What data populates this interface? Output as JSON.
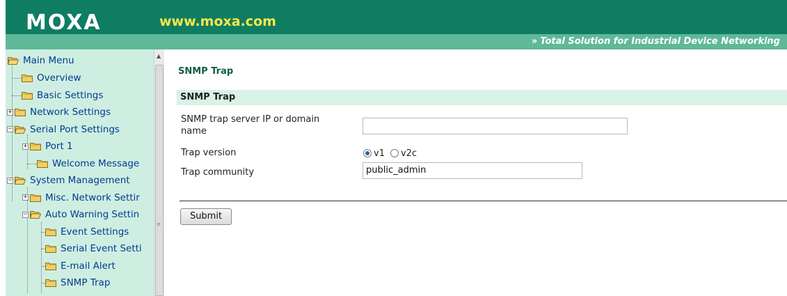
{
  "header": {
    "logo_text": "MOXA",
    "logo_url": "www.moxa.com",
    "tagline_arrows": "»",
    "tagline": "Total Solution for Industrial Device Networking",
    "colors": {
      "dark_green": "#0f7d62",
      "light_green": "#5fb89a",
      "url_yellow": "#f7e84a"
    }
  },
  "sidebar": {
    "root": "Main Menu",
    "items": [
      {
        "label": "Overview",
        "expander": "",
        "icon": "folder-closed-icon"
      },
      {
        "label": "Basic Settings",
        "expander": "",
        "icon": "folder-closed-icon"
      },
      {
        "label": "Network Settings",
        "expander": "+",
        "icon": "folder-closed-icon"
      },
      {
        "label": "Serial Port Settings",
        "expander": "-",
        "icon": "folder-open-icon"
      },
      {
        "label": "Port 1",
        "expander": "+",
        "icon": "folder-closed-icon"
      },
      {
        "label": "Welcome Message",
        "expander": "",
        "icon": "folder-closed-icon"
      },
      {
        "label": "System Management",
        "expander": "-",
        "icon": "folder-open-icon"
      },
      {
        "label": "Misc. Network Settir",
        "expander": "+",
        "icon": "folder-closed-icon"
      },
      {
        "label": "Auto Warning Settin",
        "expander": "-",
        "icon": "folder-open-icon"
      },
      {
        "label": "Event Settings",
        "expander": "",
        "icon": "folder-closed-icon"
      },
      {
        "label": "Serial Event Setti",
        "expander": "",
        "icon": "folder-closed-icon"
      },
      {
        "label": "E-mail Alert",
        "expander": "",
        "icon": "folder-closed-icon"
      },
      {
        "label": "SNMP Trap",
        "expander": "",
        "icon": "folder-closed-icon"
      }
    ],
    "bg_color": "#cfeee2"
  },
  "main": {
    "page_title": "SNMP Trap",
    "section_title": "SNMP Trap",
    "server_label_line1": "SNMP trap server IP or domain",
    "server_label_line2": "name",
    "server_value": "",
    "version_label": "Trap version",
    "version_options": [
      "v1",
      "v2c"
    ],
    "version_selected": "v1",
    "community_label": "Trap community",
    "community_value": "public_admin",
    "submit_label": "Submit"
  }
}
